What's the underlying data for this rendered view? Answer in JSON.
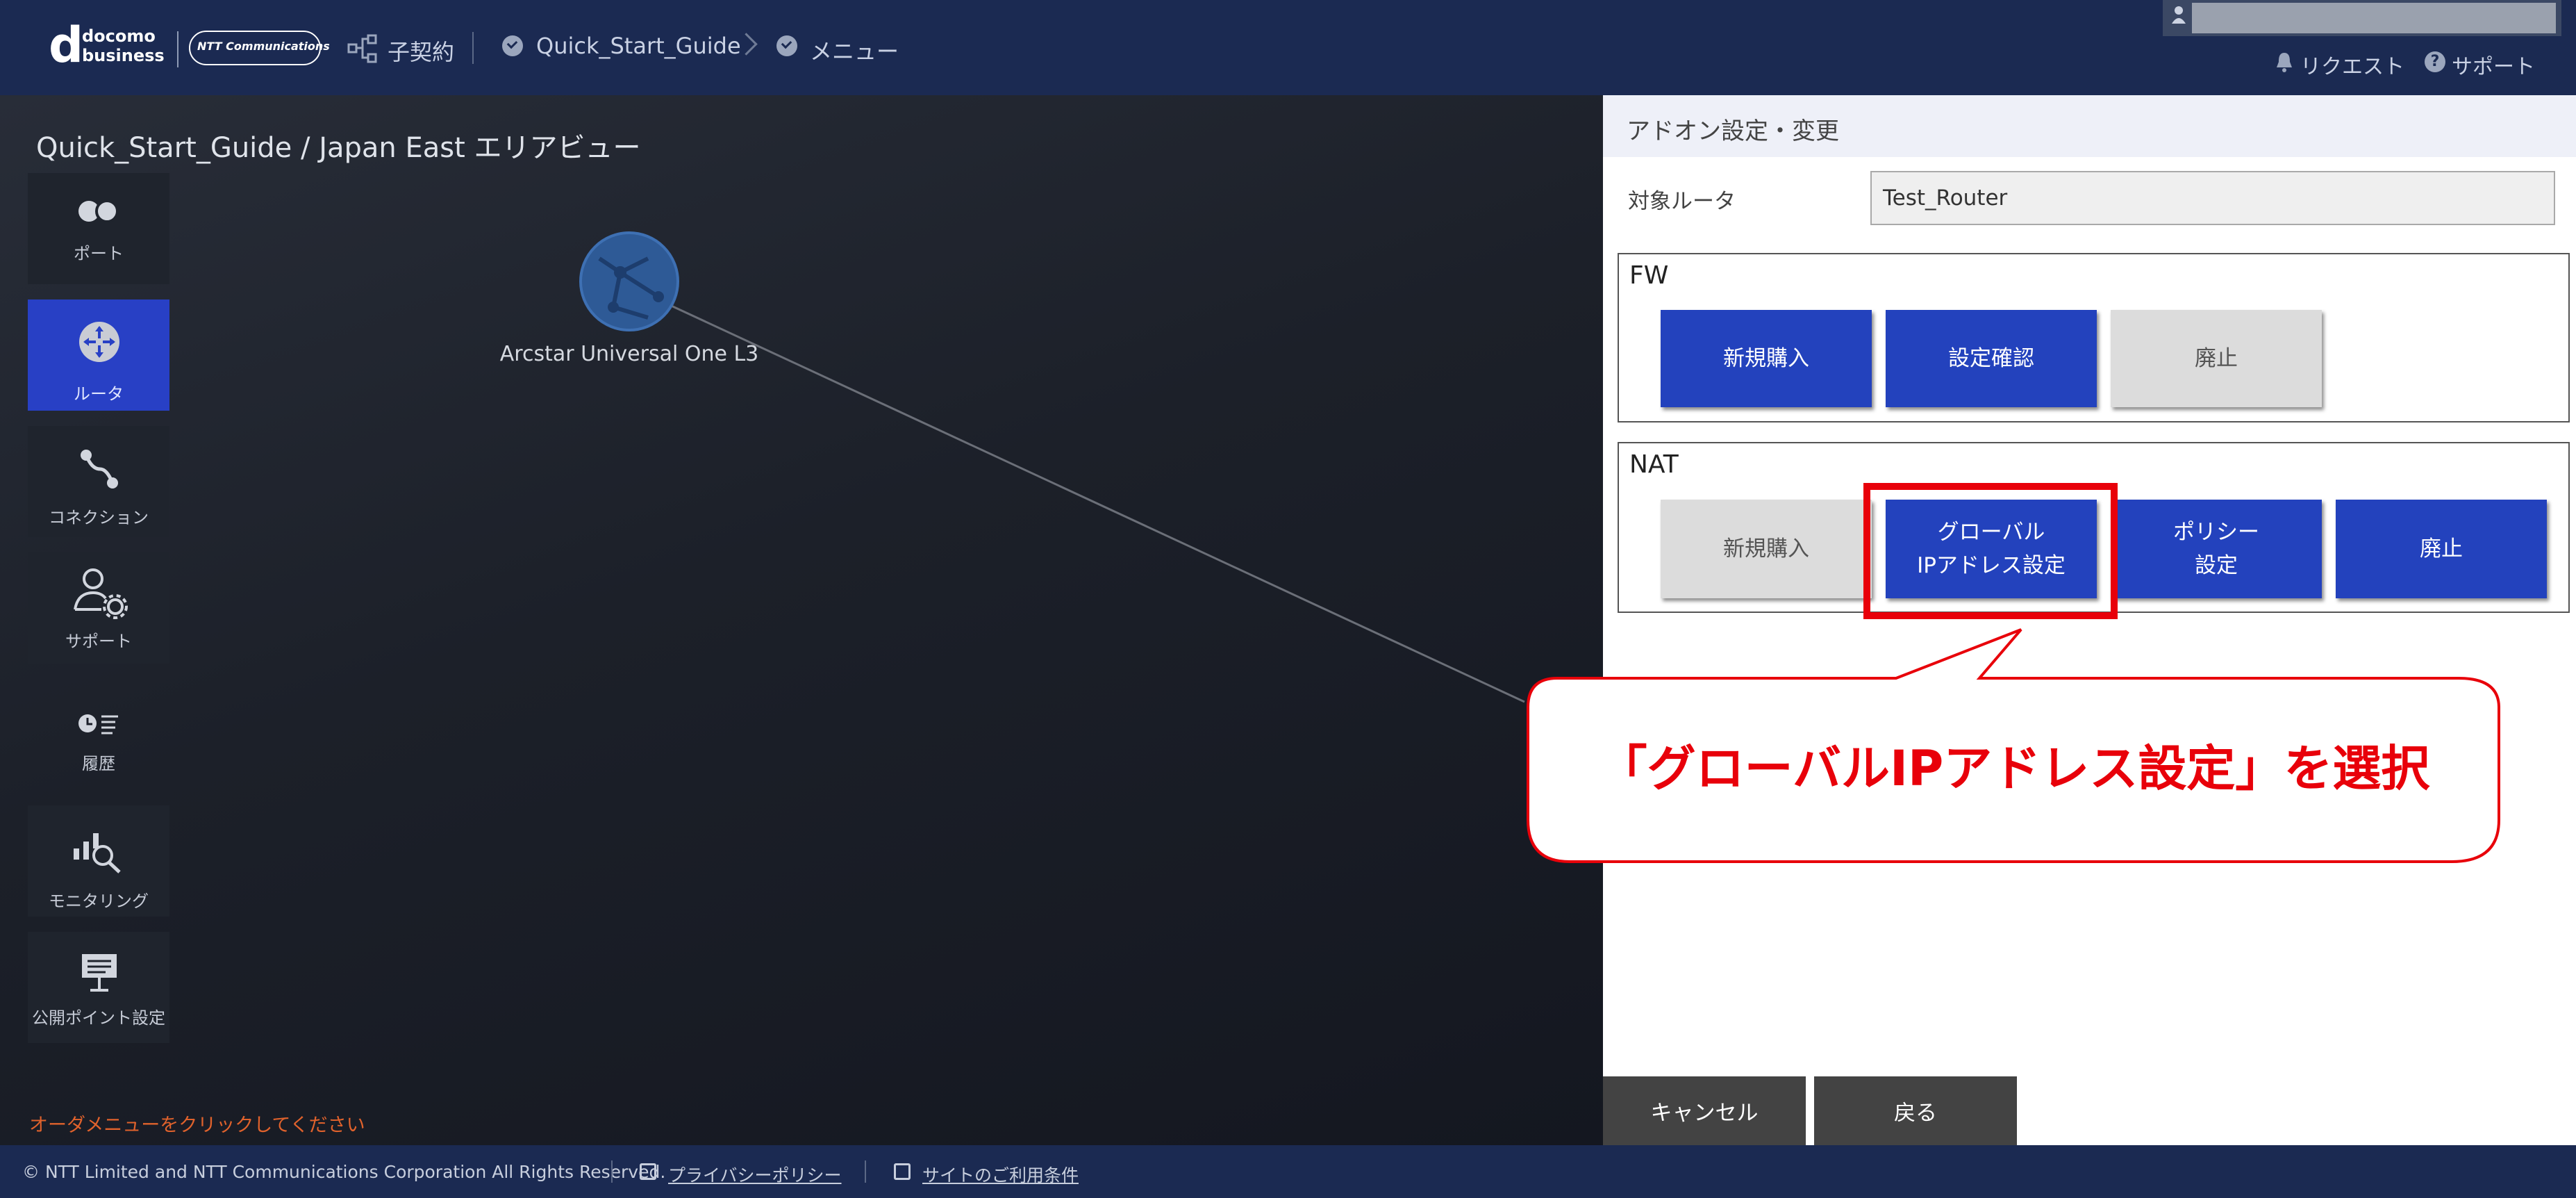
{
  "header": {
    "logo_word": "docomo",
    "logo_word2": "business",
    "ntt_logo": "NTT Communications",
    "contract": "子契約",
    "crumb1": "Quick_Start_Guide",
    "crumb2": "メニュー",
    "request": "リクエスト",
    "support": "サポート"
  },
  "map": {
    "title": "Quick_Start_Guide / Japan East エリアビュー",
    "node_label": "Arcstar Universal One L3",
    "order_hint": "オーダメニューをクリックしてください"
  },
  "sidebar": {
    "items": [
      {
        "label": "ポート",
        "icon": "port-icon"
      },
      {
        "label": "ルータ",
        "icon": "router-icon",
        "active": true
      },
      {
        "label": "コネクション",
        "icon": "connection-icon"
      },
      {
        "label": "サポート",
        "icon": "support-user-gear-icon"
      },
      {
        "label": "履歴",
        "icon": "history-icon"
      },
      {
        "label": "モニタリング",
        "icon": "monitoring-icon"
      },
      {
        "label": "公開ポイント設定",
        "icon": "public-point-icon"
      }
    ]
  },
  "panel": {
    "title": "アドオン設定・変更",
    "target_label": "対象ルータ",
    "target_value": "Test_Router",
    "fw": {
      "title": "FW",
      "buttons": [
        "新規購入",
        "設定確認",
        "廃止"
      ]
    },
    "nat": {
      "title": "NAT",
      "buttons": [
        "新規購入",
        "グローバル\nIPアドレス設定",
        "ポリシー\n設定",
        "廃止"
      ]
    },
    "cancel": "キャンセル",
    "back": "戻る"
  },
  "callout": {
    "text": "「グローバルIPアドレス設定」を選択"
  },
  "footer": {
    "copyright": "© NTT Limited and NTT Communications Corporation All Rights Reserved.",
    "privacy": "プライバシーポリシー",
    "terms": "サイトのご利用条件"
  },
  "colors": {
    "header": "#1b2a52",
    "accent_button": "#2342bd",
    "highlight": "#e8000a",
    "hint_text": "#e0622c"
  }
}
